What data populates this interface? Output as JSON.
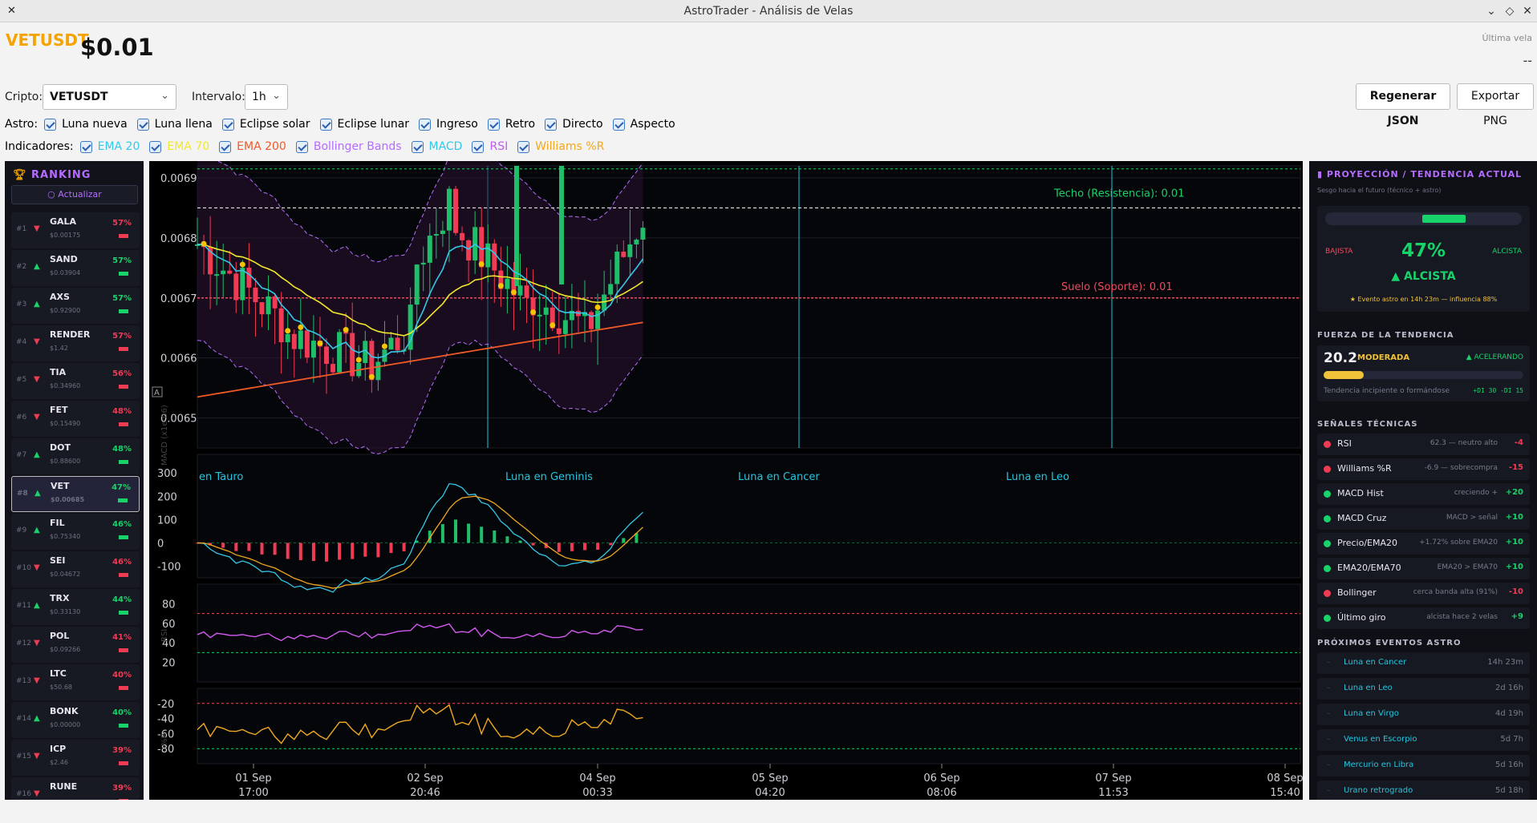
{
  "window": {
    "title": "AstroTrader - Análisis de Velas"
  },
  "header": {
    "symbol": "VETUSDT",
    "price": "$0.01",
    "last_candle_label": "Última vela",
    "last_candle_value": "--"
  },
  "controls": {
    "crypto_label": "Cripto:",
    "crypto_value": "VETUSDT",
    "interval_label": "Intervalo:",
    "interval_value": "1h",
    "regen_button": "Regenerar JSON",
    "export_button": "Exportar PNG"
  },
  "astro": {
    "label": "Astro:",
    "items": [
      "Luna nueva",
      "Luna llena",
      "Eclipse solar",
      "Eclipse lunar",
      "Ingreso",
      "Retro",
      "Directo",
      "Aspecto"
    ]
  },
  "indicators": {
    "label": "Indicadores:",
    "items": [
      {
        "name": "EMA 20",
        "color": "#35c8e8"
      },
      {
        "name": "EMA 70",
        "color": "#f2e82a"
      },
      {
        "name": "EMA 200",
        "color": "#f05a28"
      },
      {
        "name": "Bollinger Bands",
        "color": "#b56cff"
      },
      {
        "name": "MACD",
        "color": "#35c8e8"
      },
      {
        "name": "RSI",
        "color": "#c05af0"
      },
      {
        "name": "Williams %R",
        "color": "#f0a820"
      }
    ]
  },
  "ranking": {
    "title": "RANKING",
    "refresh": "Actualizar",
    "items": [
      {
        "rank": "#1",
        "sym": "GALA",
        "price": "$0.00175",
        "pct": "57%",
        "dir": "down"
      },
      {
        "rank": "#2",
        "sym": "SAND",
        "price": "$0.03904",
        "pct": "57%",
        "dir": "up"
      },
      {
        "rank": "#3",
        "sym": "AXS",
        "price": "$0.92900",
        "pct": "57%",
        "dir": "up"
      },
      {
        "rank": "#4",
        "sym": "RENDER",
        "price": "$1.42",
        "pct": "57%",
        "dir": "down"
      },
      {
        "rank": "#5",
        "sym": "TIA",
        "price": "$0.34960",
        "pct": "56%",
        "dir": "down"
      },
      {
        "rank": "#6",
        "sym": "FET",
        "price": "$0.15490",
        "pct": "48%",
        "dir": "down"
      },
      {
        "rank": "#7",
        "sym": "DOT",
        "price": "$0.88600",
        "pct": "48%",
        "dir": "up"
      },
      {
        "rank": "#8",
        "sym": "VET",
        "price": "$0.00685",
        "pct": "47%",
        "dir": "up"
      },
      {
        "rank": "#9",
        "sym": "FIL",
        "price": "$0.75340",
        "pct": "46%",
        "dir": "up"
      },
      {
        "rank": "#10",
        "sym": "SEI",
        "price": "$0.04672",
        "pct": "46%",
        "dir": "down"
      },
      {
        "rank": "#11",
        "sym": "TRX",
        "price": "$0.33130",
        "pct": "44%",
        "dir": "up"
      },
      {
        "rank": "#12",
        "sym": "POL",
        "price": "$0.09266",
        "pct": "41%",
        "dir": "down"
      },
      {
        "rank": "#13",
        "sym": "LTC",
        "price": "$50.68",
        "pct": "40%",
        "dir": "down"
      },
      {
        "rank": "#14",
        "sym": "BONK",
        "price": "$0.00000",
        "pct": "40%",
        "dir": "up"
      },
      {
        "rank": "#15",
        "sym": "ICP",
        "price": "$2.46",
        "pct": "39%",
        "dir": "down"
      },
      {
        "rank": "#16",
        "sym": "RUNE",
        "price": "",
        "pct": "39%",
        "dir": "down"
      }
    ]
  },
  "chart": {
    "price_ticks": [
      "0.0069",
      "0.0068",
      "0.0067",
      "0.0066",
      "0.0065"
    ],
    "resistance": "Techo (Resistencia): 0.01",
    "support": "Suelo (Soporte): 0.01",
    "moon_labels": [
      "en Tauro",
      "Luna en Geminis",
      "Luna en Cancer",
      "Luna en Leo"
    ],
    "macd_ticks": [
      "300",
      "200",
      "100",
      "0",
      "-100"
    ],
    "macd_axis": "MACD (x1e-06)",
    "rsi_ticks": [
      "80",
      "60",
      "40",
      "20"
    ],
    "rsi_axis": "RSI",
    "wr_ticks": [
      "-20",
      "-40",
      "-60",
      "-80"
    ],
    "wr_axis": "%R",
    "x_ticks": [
      [
        "01 Sep",
        "17:00"
      ],
      [
        "02 Sep",
        "20:46"
      ],
      [
        "04 Sep",
        "00:33"
      ],
      [
        "05 Sep",
        "04:20"
      ],
      [
        "06 Sep",
        "08:06"
      ],
      [
        "07 Sep",
        "11:53"
      ],
      [
        "08 Sep",
        "15:40"
      ]
    ],
    "autoscale_label": "A"
  },
  "chart_data": {
    "type": "candlestick",
    "price_ylim": [
      0.00645,
      0.00692
    ],
    "resistance_level": 0.00685,
    "support_level": 0.0067,
    "ema_levels": {
      "ema20_last": 0.00673,
      "ema70_last": 0.00671,
      "ema200_last": 0.00666
    },
    "rsi_bands": [
      70,
      30
    ],
    "wr_bands": [
      -20,
      -80
    ],
    "macd_ylim": [
      -150,
      380
    ],
    "rsi_ylim": [
      0,
      100
    ],
    "wr_ylim": [
      -100,
      0
    ]
  },
  "side": {
    "title": "PROYECCIÓN / TENDENCIA ACTUAL",
    "subtitle": "Sesgo hacia el futuro (técnico + astro)",
    "bearish": "BAJISTA",
    "bullish": "ALCISTA",
    "pct": "47%",
    "direction": "▲ ALCISTA",
    "event_note": "★ Evento astro en 14h 23m — influencia 88%",
    "strength_title": "FUERZA DE LA TENDENCIA",
    "strength_value": "20.2",
    "strength_label": "MODERADA",
    "strength_state": "▲ ACELERANDO",
    "strength_desc": "Tendencia incipiente o formándose",
    "di": "+DI 30  -DI 15",
    "strength_fill": 0.2,
    "signals_title": "SEÑALES TÉCNICAS",
    "signals": [
      {
        "name": "RSI",
        "desc": "62.3 — neutro alto",
        "val": "-4",
        "pos": false
      },
      {
        "name": "Williams %R",
        "desc": "-6.9 — sobrecompra",
        "val": "-15",
        "pos": false
      },
      {
        "name": "MACD Hist",
        "desc": "creciendo +",
        "val": "+20",
        "pos": true
      },
      {
        "name": "MACD Cruz",
        "desc": "MACD > señal",
        "val": "+10",
        "pos": true
      },
      {
        "name": "Precio/EMA20",
        "desc": "+1.72% sobre EMA20",
        "val": "+10",
        "pos": true
      },
      {
        "name": "EMA20/EMA70",
        "desc": "EMA20 > EMA70",
        "val": "+10",
        "pos": true
      },
      {
        "name": "Bollinger",
        "desc": "cerca banda alta (91%)",
        "val": "-10",
        "pos": false
      },
      {
        "name": "Último giro",
        "desc": "alcista hace 2 velas",
        "val": "+9",
        "pos": true
      }
    ],
    "events_title": "PRÓXIMOS EVENTOS ASTRO",
    "events": [
      {
        "name": "Luna en Cancer",
        "time": "14h 23m"
      },
      {
        "name": "Luna en Leo",
        "time": "2d 16h"
      },
      {
        "name": "Luna en Virgo",
        "time": "4d 19h"
      },
      {
        "name": "Venus en Escorpio",
        "time": "5d 7h"
      },
      {
        "name": "Mercurio en Libra",
        "time": "5d 16h"
      },
      {
        "name": "Urano retrogrado",
        "time": "5d 18h"
      }
    ]
  }
}
